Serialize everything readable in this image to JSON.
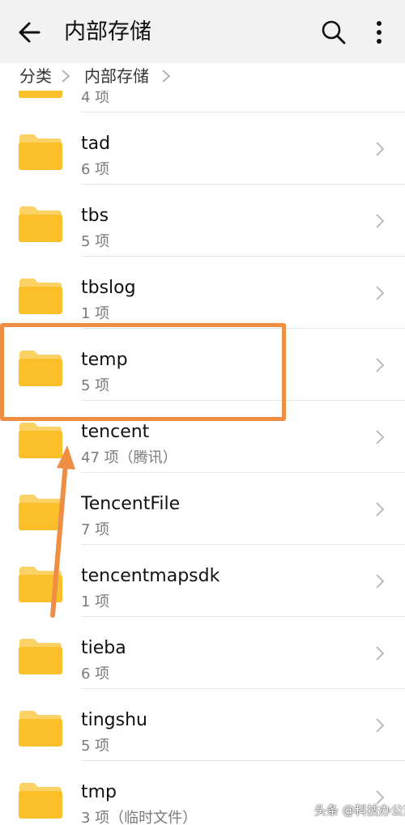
{
  "appbar": {
    "back_icon": "arrow-left-icon",
    "title": "内部存储",
    "search_icon": "search-icon",
    "more_icon": "more-vertical-icon"
  },
  "breadcrumb": {
    "items": [
      "分类",
      "内部存储"
    ]
  },
  "folder_color": "#fbbf2a",
  "folder_tab_color": "#fcd166",
  "highlight_color": "#ee8e44",
  "folders": [
    {
      "name": "",
      "count": "4 项"
    },
    {
      "name": "tad",
      "count": "6 项"
    },
    {
      "name": "tbs",
      "count": "5 项"
    },
    {
      "name": "tbslog",
      "count": "1 项"
    },
    {
      "name": "temp",
      "count": "5 项"
    },
    {
      "name": "tencent",
      "count": "47 项（腾讯）"
    },
    {
      "name": "TencentFile",
      "count": "7 项"
    },
    {
      "name": "tencentmapsdk",
      "count": "1 项"
    },
    {
      "name": "tieba",
      "count": "6 项"
    },
    {
      "name": "tingshu",
      "count": "5 项"
    },
    {
      "name": "tmp",
      "count": "3 项（临时文件）"
    }
  ],
  "watermark": "头条 @科技办公室"
}
